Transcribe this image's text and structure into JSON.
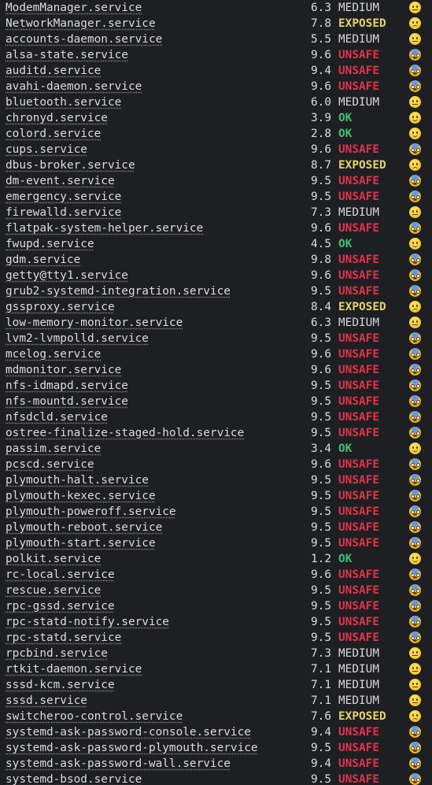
{
  "units": [
    {
      "unit": "ModemManager.service",
      "exposure": "6.3",
      "predicate": "MEDIUM",
      "icon": "neutral-face-icon"
    },
    {
      "unit": "NetworkManager.service",
      "exposure": "7.8",
      "predicate": "EXPOSED",
      "icon": "slightly-frowning-face-icon"
    },
    {
      "unit": "accounts-daemon.service",
      "exposure": "5.5",
      "predicate": "MEDIUM",
      "icon": "neutral-face-icon"
    },
    {
      "unit": "alsa-state.service",
      "exposure": "9.6",
      "predicate": "UNSAFE",
      "icon": "fearful-face-icon"
    },
    {
      "unit": "auditd.service",
      "exposure": "9.4",
      "predicate": "UNSAFE",
      "icon": "fearful-face-icon"
    },
    {
      "unit": "avahi-daemon.service",
      "exposure": "9.6",
      "predicate": "UNSAFE",
      "icon": "fearful-face-icon"
    },
    {
      "unit": "bluetooth.service",
      "exposure": "6.0",
      "predicate": "MEDIUM",
      "icon": "neutral-face-icon"
    },
    {
      "unit": "chronyd.service",
      "exposure": "3.9",
      "predicate": "OK",
      "icon": "slightly-smiling-face-icon"
    },
    {
      "unit": "colord.service",
      "exposure": "2.8",
      "predicate": "OK",
      "icon": "slightly-smiling-face-icon"
    },
    {
      "unit": "cups.service",
      "exposure": "9.6",
      "predicate": "UNSAFE",
      "icon": "fearful-face-icon"
    },
    {
      "unit": "dbus-broker.service",
      "exposure": "8.7",
      "predicate": "EXPOSED",
      "icon": "slightly-frowning-face-icon"
    },
    {
      "unit": "dm-event.service",
      "exposure": "9.5",
      "predicate": "UNSAFE",
      "icon": "fearful-face-icon"
    },
    {
      "unit": "emergency.service",
      "exposure": "9.5",
      "predicate": "UNSAFE",
      "icon": "fearful-face-icon"
    },
    {
      "unit": "firewalld.service",
      "exposure": "7.3",
      "predicate": "MEDIUM",
      "icon": "neutral-face-icon"
    },
    {
      "unit": "flatpak-system-helper.service",
      "exposure": "9.6",
      "predicate": "UNSAFE",
      "icon": "fearful-face-icon"
    },
    {
      "unit": "fwupd.service",
      "exposure": "4.5",
      "predicate": "OK",
      "icon": "slightly-smiling-face-icon"
    },
    {
      "unit": "gdm.service",
      "exposure": "9.8",
      "predicate": "UNSAFE",
      "icon": "fearful-face-icon"
    },
    {
      "unit": "getty@tty1.service",
      "exposure": "9.6",
      "predicate": "UNSAFE",
      "icon": "fearful-face-icon"
    },
    {
      "unit": "grub2-systemd-integration.service",
      "exposure": "9.5",
      "predicate": "UNSAFE",
      "icon": "fearful-face-icon"
    },
    {
      "unit": "gssproxy.service",
      "exposure": "8.4",
      "predicate": "EXPOSED",
      "icon": "slightly-frowning-face-icon"
    },
    {
      "unit": "low-memory-monitor.service",
      "exposure": "6.3",
      "predicate": "MEDIUM",
      "icon": "neutral-face-icon"
    },
    {
      "unit": "lvm2-lvmpolld.service",
      "exposure": "9.5",
      "predicate": "UNSAFE",
      "icon": "fearful-face-icon"
    },
    {
      "unit": "mcelog.service",
      "exposure": "9.6",
      "predicate": "UNSAFE",
      "icon": "fearful-face-icon"
    },
    {
      "unit": "mdmonitor.service",
      "exposure": "9.6",
      "predicate": "UNSAFE",
      "icon": "fearful-face-icon"
    },
    {
      "unit": "nfs-idmapd.service",
      "exposure": "9.5",
      "predicate": "UNSAFE",
      "icon": "fearful-face-icon"
    },
    {
      "unit": "nfs-mountd.service",
      "exposure": "9.5",
      "predicate": "UNSAFE",
      "icon": "fearful-face-icon"
    },
    {
      "unit": "nfsdcld.service",
      "exposure": "9.5",
      "predicate": "UNSAFE",
      "icon": "fearful-face-icon"
    },
    {
      "unit": "ostree-finalize-staged-hold.service",
      "exposure": "9.5",
      "predicate": "UNSAFE",
      "icon": "fearful-face-icon"
    },
    {
      "unit": "passim.service",
      "exposure": "3.4",
      "predicate": "OK",
      "icon": "slightly-smiling-face-icon"
    },
    {
      "unit": "pcscd.service",
      "exposure": "9.6",
      "predicate": "UNSAFE",
      "icon": "fearful-face-icon"
    },
    {
      "unit": "plymouth-halt.service",
      "exposure": "9.5",
      "predicate": "UNSAFE",
      "icon": "fearful-face-icon"
    },
    {
      "unit": "plymouth-kexec.service",
      "exposure": "9.5",
      "predicate": "UNSAFE",
      "icon": "fearful-face-icon"
    },
    {
      "unit": "plymouth-poweroff.service",
      "exposure": "9.5",
      "predicate": "UNSAFE",
      "icon": "fearful-face-icon"
    },
    {
      "unit": "plymouth-reboot.service",
      "exposure": "9.5",
      "predicate": "UNSAFE",
      "icon": "fearful-face-icon"
    },
    {
      "unit": "plymouth-start.service",
      "exposure": "9.5",
      "predicate": "UNSAFE",
      "icon": "fearful-face-icon"
    },
    {
      "unit": "polkit.service",
      "exposure": "1.2",
      "predicate": "OK",
      "icon": "slightly-smiling-face-icon"
    },
    {
      "unit": "rc-local.service",
      "exposure": "9.6",
      "predicate": "UNSAFE",
      "icon": "fearful-face-icon"
    },
    {
      "unit": "rescue.service",
      "exposure": "9.5",
      "predicate": "UNSAFE",
      "icon": "fearful-face-icon"
    },
    {
      "unit": "rpc-gssd.service",
      "exposure": "9.5",
      "predicate": "UNSAFE",
      "icon": "fearful-face-icon"
    },
    {
      "unit": "rpc-statd-notify.service",
      "exposure": "9.5",
      "predicate": "UNSAFE",
      "icon": "fearful-face-icon"
    },
    {
      "unit": "rpc-statd.service",
      "exposure": "9.5",
      "predicate": "UNSAFE",
      "icon": "fearful-face-icon"
    },
    {
      "unit": "rpcbind.service",
      "exposure": "7.3",
      "predicate": "MEDIUM",
      "icon": "neutral-face-icon"
    },
    {
      "unit": "rtkit-daemon.service",
      "exposure": "7.1",
      "predicate": "MEDIUM",
      "icon": "neutral-face-icon"
    },
    {
      "unit": "sssd-kcm.service",
      "exposure": "7.1",
      "predicate": "MEDIUM",
      "icon": "neutral-face-icon"
    },
    {
      "unit": "sssd.service",
      "exposure": "7.1",
      "predicate": "MEDIUM",
      "icon": "neutral-face-icon"
    },
    {
      "unit": "switcheroo-control.service",
      "exposure": "7.6",
      "predicate": "EXPOSED",
      "icon": "slightly-frowning-face-icon"
    },
    {
      "unit": "systemd-ask-password-console.service",
      "exposure": "9.4",
      "predicate": "UNSAFE",
      "icon": "fearful-face-icon"
    },
    {
      "unit": "systemd-ask-password-plymouth.service",
      "exposure": "9.5",
      "predicate": "UNSAFE",
      "icon": "fearful-face-icon"
    },
    {
      "unit": "systemd-ask-password-wall.service",
      "exposure": "9.4",
      "predicate": "UNSAFE",
      "icon": "fearful-face-icon"
    },
    {
      "unit": "systemd-bsod.service",
      "exposure": "9.5",
      "predicate": "UNSAFE",
      "icon": "fearful-face-icon"
    }
  ],
  "colors": {
    "background": "#1e1f22",
    "text": "#dcdcdc",
    "ok": "#3fc36e",
    "exposed": "#e8d36a",
    "unsafe": "#e0344a"
  }
}
